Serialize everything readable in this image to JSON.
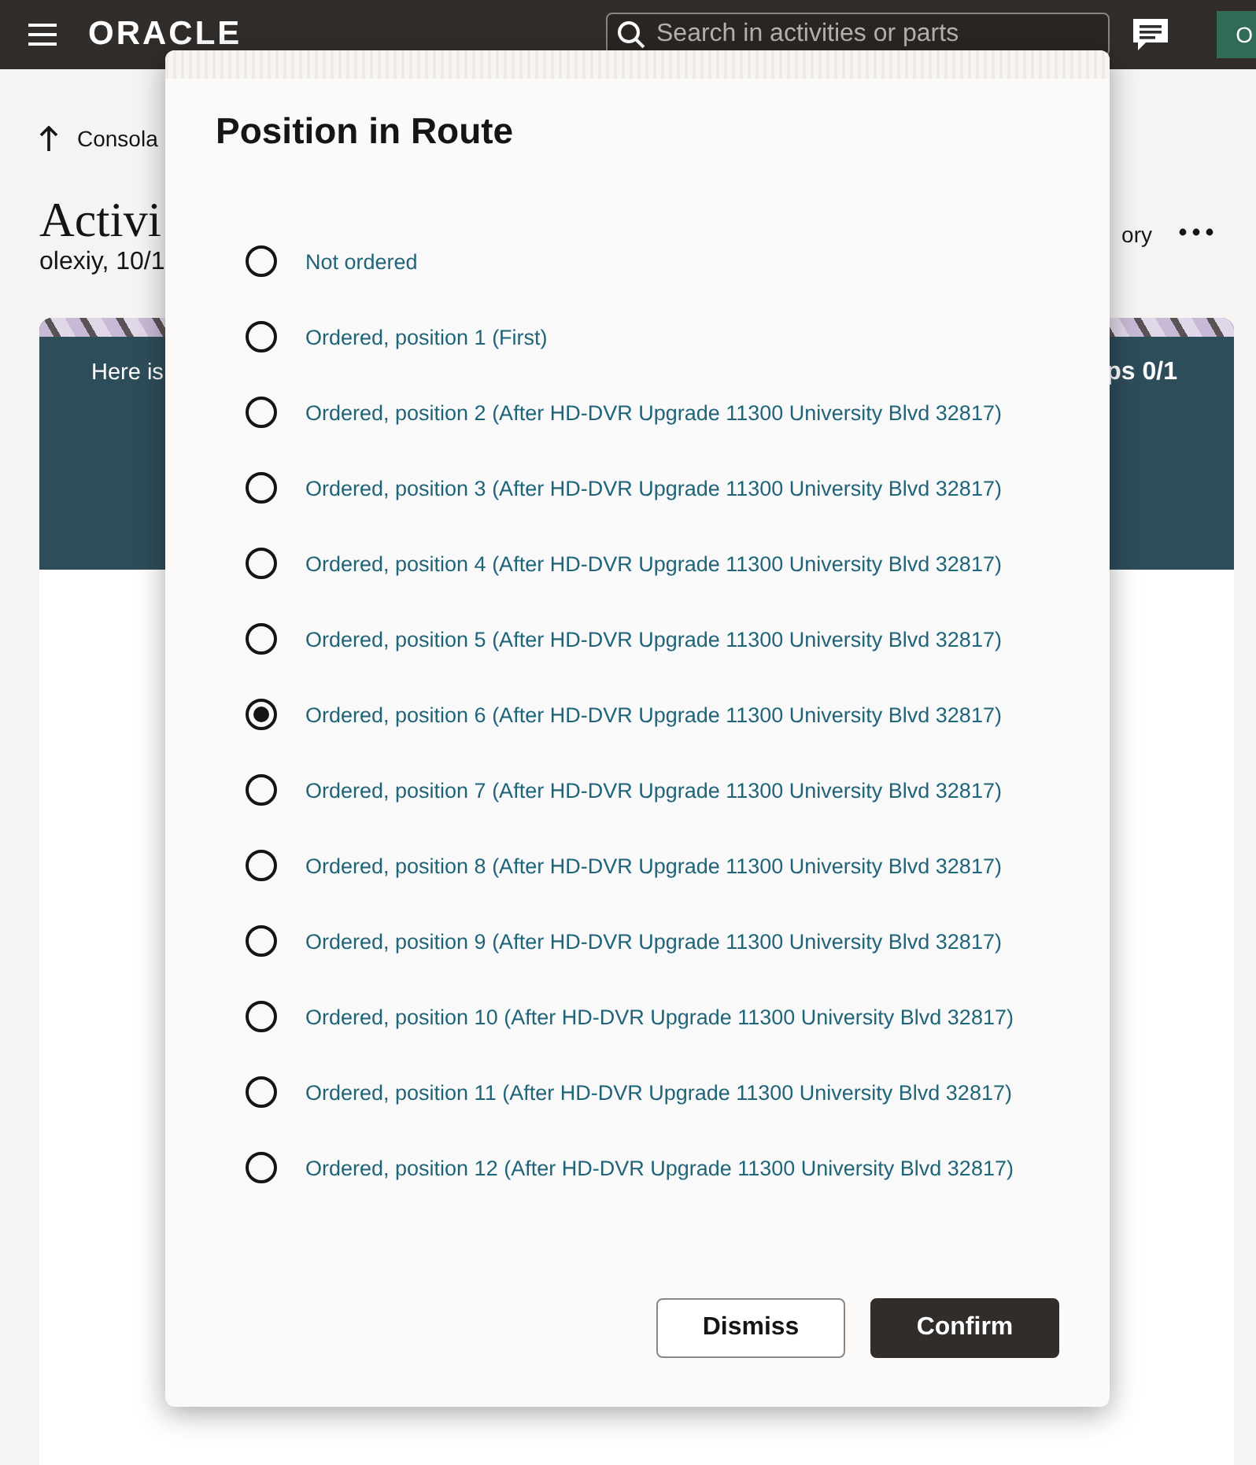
{
  "header": {
    "logo": "ORACLE",
    "search": {
      "placeholder": "Search in activities or parts"
    },
    "avatar": "O"
  },
  "page": {
    "back_link": "Consola",
    "title": "Activi",
    "subtitle": "olexiy, 10/1",
    "action_partial": "ory",
    "banner": {
      "text": "Here is",
      "steps": "ps 0/1"
    }
  },
  "dialog": {
    "title": "Position in Route",
    "options": [
      {
        "label": "Not ordered",
        "selected": false
      },
      {
        "label": "Ordered, position 1 (First)",
        "selected": false
      },
      {
        "label": "Ordered, position 2 (After HD-DVR Upgrade 11300 University Blvd 32817)",
        "selected": false
      },
      {
        "label": "Ordered, position 3 (After HD-DVR Upgrade 11300 University Blvd 32817)",
        "selected": false
      },
      {
        "label": "Ordered, position 4 (After HD-DVR Upgrade 11300 University Blvd 32817)",
        "selected": false
      },
      {
        "label": "Ordered, position 5 (After HD-DVR Upgrade 11300 University Blvd 32817)",
        "selected": false
      },
      {
        "label": "Ordered, position 6 (After HD-DVR Upgrade 11300 University Blvd 32817)",
        "selected": true
      },
      {
        "label": "Ordered, position 7 (After HD-DVR Upgrade 11300 University Blvd 32817)",
        "selected": false
      },
      {
        "label": "Ordered, position 8 (After HD-DVR Upgrade 11300 University Blvd 32817)",
        "selected": false
      },
      {
        "label": "Ordered, position 9 (After HD-DVR Upgrade 11300 University Blvd 32817)",
        "selected": false
      },
      {
        "label": "Ordered, position 10 (After HD-DVR Upgrade 11300 University Blvd 32817)",
        "selected": false
      },
      {
        "label": "Ordered, position 11 (After HD-DVR Upgrade 11300 University Blvd 32817)",
        "selected": false
      },
      {
        "label": "Ordered, position 12 (After HD-DVR Upgrade 11300 University Blvd 32817)",
        "selected": false
      }
    ],
    "buttons": [
      {
        "label": "Dismiss",
        "kind": "secondary"
      },
      {
        "label": "Confirm",
        "kind": "primary"
      }
    ]
  }
}
